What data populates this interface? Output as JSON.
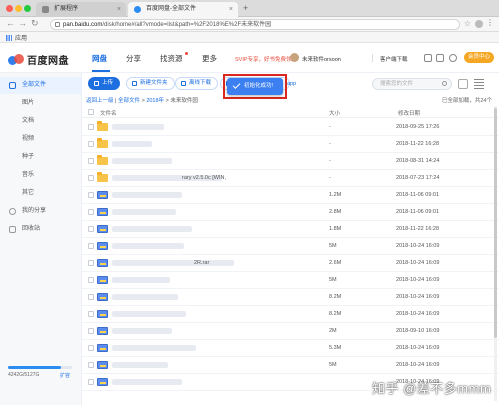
{
  "browser": {
    "tabs": [
      {
        "label": "扩展程序"
      },
      {
        "label": "百度网盘-全部文件"
      }
    ],
    "url_domain": "pan.baidu.com",
    "url_path": "/disk/home#/all?vmode=list&path=%2F2018%E%2F未来软件园",
    "bookmark_apps": "应用"
  },
  "header": {
    "logo": "百度网盘",
    "nav": [
      "网盘",
      "分享",
      "找资源",
      "更多"
    ],
    "svip_promo": "SVIP专享，好书免费领",
    "user_name": "未来软件orsoon",
    "client_download": "客户端下载",
    "vip_button": "会员中心"
  },
  "sidebar": {
    "items": [
      {
        "label": "全部文件"
      },
      {
        "label": "图片"
      },
      {
        "label": "文档"
      },
      {
        "label": "视频"
      },
      {
        "label": "种子"
      },
      {
        "label": "音乐"
      },
      {
        "label": "其它"
      },
      {
        "label": "我的分享"
      },
      {
        "label": "回收站"
      }
    ],
    "quota_text": "4242G/5127G",
    "quota_fraction": 0.83,
    "quota_expand": "扩容"
  },
  "toolbar": {
    "upload": "上传",
    "new_folder": "新建文件夹",
    "offline_download": "离线下载",
    "app_suffix": "app",
    "search_placeholder": "搜索您的文件"
  },
  "toast": {
    "text": "初始化成功!"
  },
  "breadcrumb": {
    "back": "返回上一级",
    "sep": "|",
    "all_files": "全部文件",
    "level1": "2018年",
    "current": "未来软件园",
    "status": "已全部加载，共24个"
  },
  "table": {
    "headers": {
      "name": "文件名",
      "size": "大小",
      "modified": "修改日期"
    },
    "rows": [
      {
        "type": "folder",
        "name": "",
        "size": "-",
        "date": "2018-09-25 17:26"
      },
      {
        "type": "folder",
        "name": "",
        "size": "-",
        "date": "2018-11-22 16:28"
      },
      {
        "type": "folder",
        "name": "",
        "size": "-",
        "date": "2018-08-31 14:24"
      },
      {
        "type": "folder",
        "name": "rary v2.5.0c [WIN,",
        "size": "-",
        "date": "2018-07-23 17:24"
      },
      {
        "type": "rar",
        "name": "",
        "size": "1.2M",
        "date": "2018-11-06 09:01"
      },
      {
        "type": "rar",
        "name": "",
        "size": "2.8M",
        "date": "2018-11-06 09:01"
      },
      {
        "type": "rar",
        "name": "",
        "size": "1.8M",
        "date": "2018-11-22 16:28"
      },
      {
        "type": "rar",
        "name": "",
        "size": "5M",
        "date": "2018-10-24 16:09"
      },
      {
        "type": "rar",
        "name": "2R.rar",
        "size": "2.6M",
        "date": "2018-10-24 16:09"
      },
      {
        "type": "rar",
        "name": "",
        "size": "5M",
        "date": "2018-10-24 16:09"
      },
      {
        "type": "rar",
        "name": "",
        "size": "8.2M",
        "date": "2018-10-24 16:09"
      },
      {
        "type": "rar",
        "name": "",
        "size": "8.2M",
        "date": "2018-10-24 16:09"
      },
      {
        "type": "rar",
        "name": "",
        "size": "2M",
        "date": "2018-09-10 16:09"
      },
      {
        "type": "rar",
        "name": "",
        "size": "5.3M",
        "date": "2018-10-24 16:09"
      },
      {
        "type": "rar",
        "name": "",
        "size": "5M",
        "date": "2018-10-24 16:09"
      },
      {
        "type": "rar",
        "name": "",
        "size": "",
        "date": "2018-10-24 16:09"
      }
    ]
  },
  "watermark": "知乎 @差不多mmm",
  "colors": {
    "accent": "#1d6fe0",
    "toast": "#3b7ff0",
    "highlight_frame": "#d8281f",
    "vip": "#f5a623"
  }
}
